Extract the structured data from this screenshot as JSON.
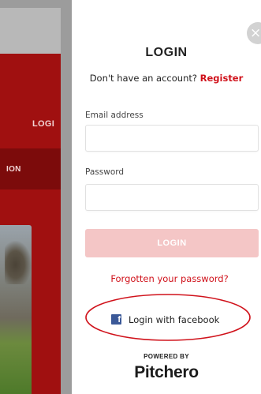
{
  "background": {
    "nav_login_text": "LOGI",
    "nav_section_text": "ION"
  },
  "modal": {
    "close_glyph": "×",
    "title": "LOGIN",
    "signup_prompt": "Don't have an account?",
    "signup_link": "Register",
    "email_label": "Email address",
    "email_value": "",
    "password_label": "Password",
    "password_value": "",
    "login_button": "LOGIN",
    "forgot_link": "Forgotten your password?",
    "facebook_icon_glyph": "f",
    "facebook_button": "Login with facebook",
    "powered_by": "POWERED BY",
    "brand": "Pitchero"
  },
  "colors": {
    "accent": "#d0121b",
    "login_button_bg": "#f4c6c6",
    "facebook_blue": "#3b5998",
    "annotation_ellipse": "#d0121b"
  }
}
